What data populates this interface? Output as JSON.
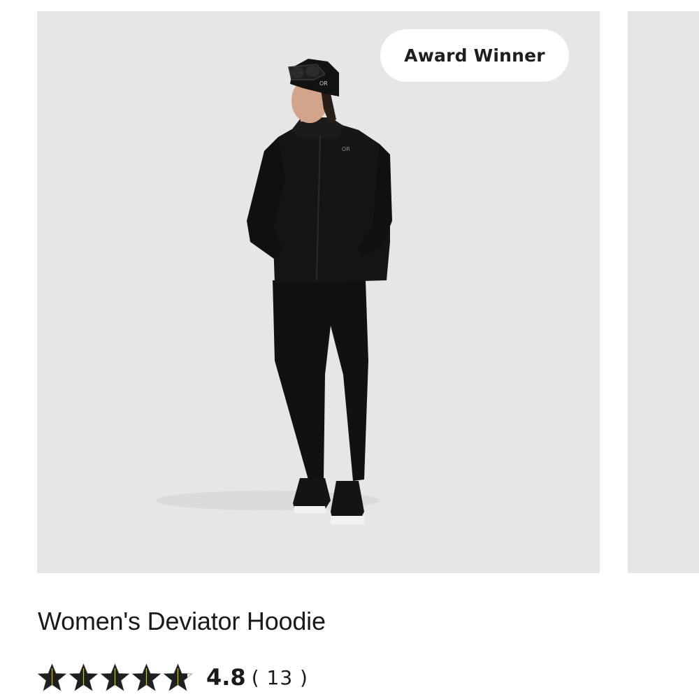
{
  "badge": {
    "label": "Award Winner"
  },
  "product": {
    "title": "Women's Deviator Hoodie",
    "rating_value": "4.8",
    "review_count": "( 13 )",
    "rating_fraction": 0.96,
    "stars_total": 5
  },
  "colors": {
    "image_background": "#e6e6e6",
    "star_fill": "#1f1f1f",
    "star_accent": "#c9c21c",
    "badge_background": "#ffffff",
    "text": "#1a1a1a"
  },
  "image": {
    "alt": "Model wearing black Deviator Hoodie, black leggings, beanie with goggles and black sneakers"
  }
}
